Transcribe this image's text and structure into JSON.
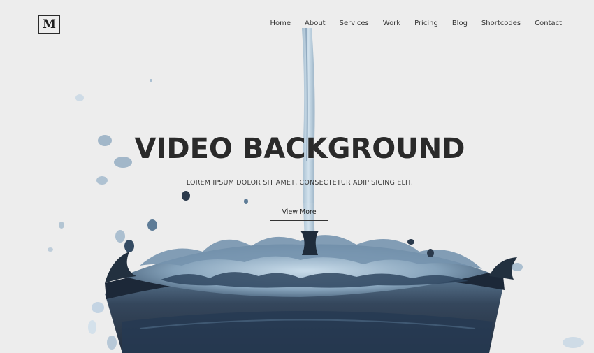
{
  "brand": {
    "logo_letter": "M"
  },
  "nav": {
    "items": [
      "Home",
      "About",
      "Services",
      "Work",
      "Pricing",
      "Blog",
      "Shortcodes",
      "Contact"
    ]
  },
  "hero": {
    "title": "VIDEO BACKGROUND",
    "subtitle": "LOREM IPSUM DOLOR SIT AMET, CONSECTETUR ADIPISICING ELIT.",
    "cta_label": "View More",
    "background": "water-splash-glass-image"
  },
  "colors": {
    "page_bg": "#ededed",
    "text_dark": "#2a2a2a",
    "water_dark": "#1f2a38",
    "water_mid": "#5f7d99",
    "water_light": "#b9cfe0"
  }
}
